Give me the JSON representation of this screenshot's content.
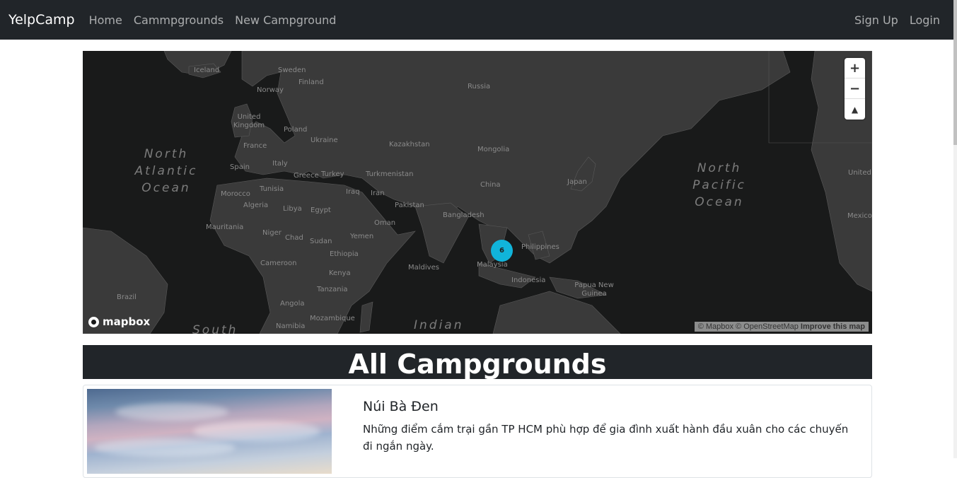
{
  "navbar": {
    "brand": "YelpCamp",
    "links": [
      "Home",
      "Cammpgrounds",
      "New Campground"
    ],
    "auth": [
      "Sign Up",
      "Login"
    ]
  },
  "map": {
    "countries": [
      "Iceland",
      "Sweden",
      "Finland",
      "Norway",
      "Russia",
      "United Kingdom",
      "Poland",
      "Ukraine",
      "France",
      "Kazakhstan",
      "Mongolia",
      "Spain",
      "Italy",
      "Greece",
      "Turkey",
      "Turkmenistan",
      "Japan",
      "China",
      "Tunisia",
      "Iraq",
      "Iran",
      "Morocco",
      "Algeria",
      "Libya",
      "Egypt",
      "Pakistan",
      "Bangladesh",
      "Mauritania",
      "Niger",
      "Chad",
      "Sudan",
      "Oman",
      "Yemen",
      "Ethiopia",
      "Philippines",
      "Maldives",
      "Malaysia",
      "Cameroon",
      "Kenya",
      "Indonesia",
      "Papua New Guinea",
      "Brazil",
      "Tanzania",
      "Angola",
      "Namibia",
      "Mozambique",
      "United",
      "Mexico"
    ],
    "oceans": [
      "North Atlantic Ocean",
      "North Pacific Ocean",
      "Indian",
      "South"
    ],
    "cluster_count": "6",
    "controls": [
      "+",
      "−",
      "▲"
    ],
    "logo": "mapbox",
    "attribution": "© Mapbox © OpenStreetMap",
    "improve": "Improve this map"
  },
  "page": {
    "heading": "All Campgrounds"
  },
  "campgrounds": [
    {
      "title": "Núi Bà Đen",
      "description": "Những điểm cắm trại gần TP HCM phù hợp để gia đình xuất hành đầu xuân cho các chuyến đi ngắn ngày."
    }
  ],
  "colors": {
    "navbar": "#212529",
    "map_bg": "#191a1a",
    "land": "#3a3a3a",
    "cluster": "#11b4da"
  }
}
